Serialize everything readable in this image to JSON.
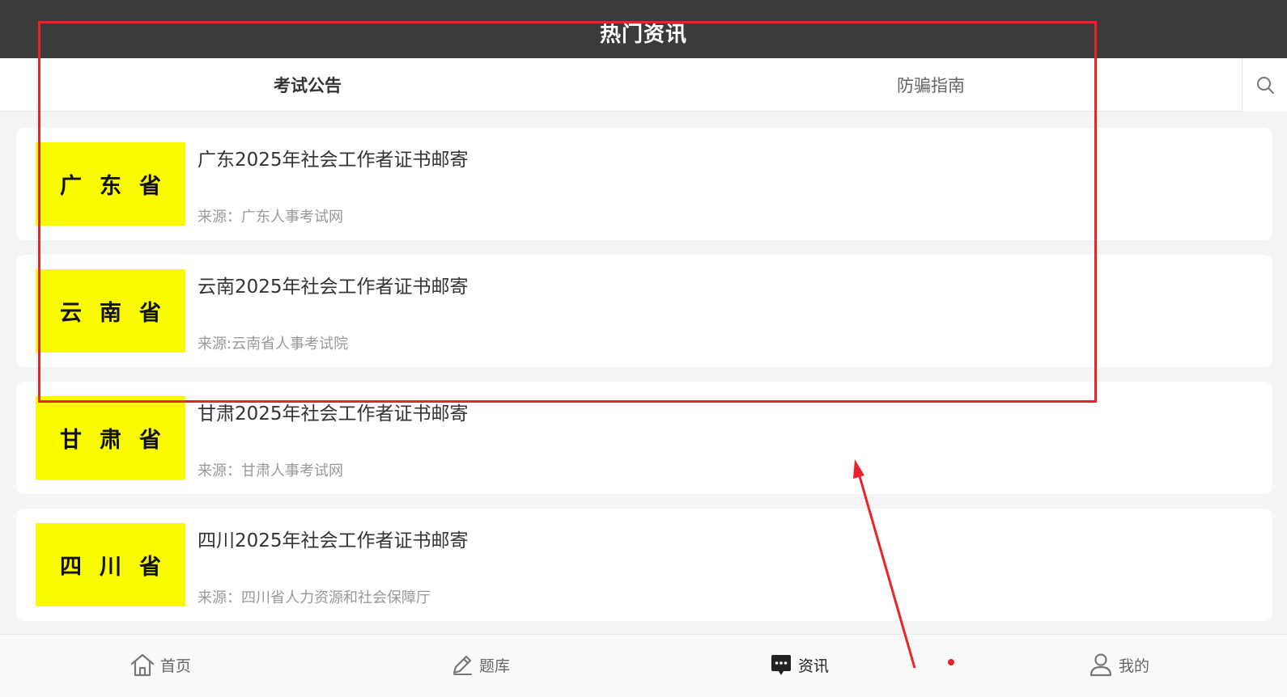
{
  "header": {
    "title": "热门资讯"
  },
  "tabs": [
    {
      "label": "考试公告",
      "active": true
    },
    {
      "label": "防骗指南",
      "active": false
    }
  ],
  "search": {
    "icon": "search-icon"
  },
  "news": [
    {
      "thumb": "广东省",
      "title": "广东2025年社会工作者证书邮寄",
      "source": "来源：广东人事考试网"
    },
    {
      "thumb": "云南省",
      "title": "云南2025年社会工作者证书邮寄",
      "source": "来源:云南省人事考试院"
    },
    {
      "thumb": "甘肃省",
      "title": "甘肃2025年社会工作者证书邮寄",
      "source": "来源：甘肃人事考试网"
    },
    {
      "thumb": "四川省",
      "title": "四川2025年社会工作者证书邮寄",
      "source": "来源：四川省人力资源和社会保障厅"
    }
  ],
  "nav": [
    {
      "label": "首页",
      "icon": "home-icon",
      "active": false
    },
    {
      "label": "题库",
      "icon": "pencil-icon",
      "active": false
    },
    {
      "label": "资讯",
      "icon": "chat-bubble-icon",
      "active": true
    },
    {
      "label": "我的",
      "icon": "user-icon",
      "active": false
    }
  ],
  "colors": {
    "header_bg": "#3b3b3b",
    "thumb_bg": "#fafa00",
    "annotation": "#e8232a",
    "page_bg": "#f4f4f4"
  }
}
